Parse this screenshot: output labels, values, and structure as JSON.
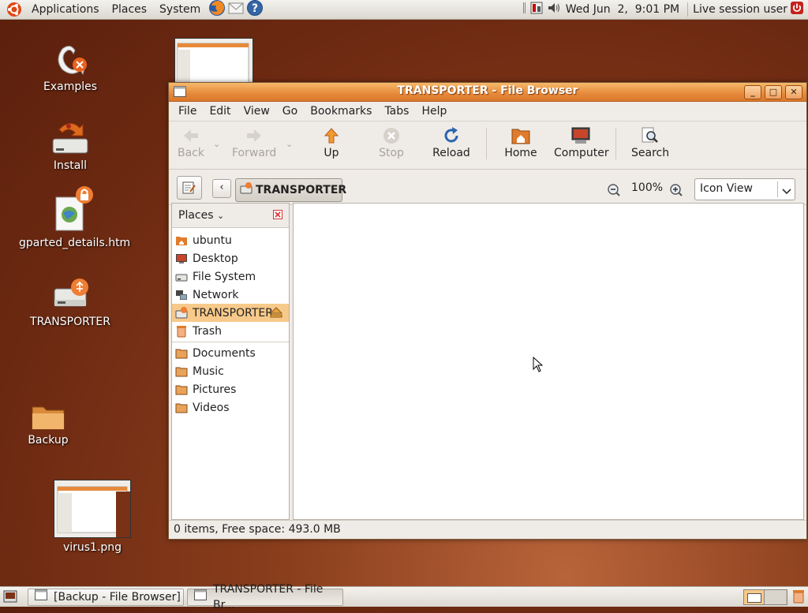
{
  "top_panel": {
    "menus": [
      "Applications",
      "Places",
      "System"
    ],
    "clock": "Wed Jun  2,  9:01 PM",
    "user": "Live session user"
  },
  "desktop": {
    "icons": [
      "Examples",
      "Install",
      "gparted_details.htm",
      "TRANSPORTER",
      "Backup",
      "virus1.png"
    ]
  },
  "window": {
    "title": "TRANSPORTER - File Browser",
    "menubar": [
      "File",
      "Edit",
      "View",
      "Go",
      "Bookmarks",
      "Tabs",
      "Help"
    ],
    "toolbar": {
      "back": "Back",
      "forward": "Forward",
      "up": "Up",
      "stop": "Stop",
      "reload": "Reload",
      "home": "Home",
      "computer": "Computer",
      "search": "Search"
    },
    "location": {
      "current": "TRANSPORTER",
      "zoom": "100%",
      "view_mode": "Icon View"
    },
    "sidebar": {
      "header": "Places",
      "places": [
        "ubuntu",
        "Desktop",
        "File System",
        "Network",
        "TRANSPORTER",
        "Trash"
      ],
      "bookmarks": [
        "Documents",
        "Music",
        "Pictures",
        "Videos"
      ]
    },
    "status": "0 items, Free space: 493.0 MB"
  },
  "taskbar": {
    "tasks": [
      "[Backup - File Browser]",
      "TRANSPORTER - File Br..."
    ]
  },
  "colors": {
    "accent": "#e7893b",
    "selection": "#f7c98a",
    "desktop": "#7a3216"
  }
}
